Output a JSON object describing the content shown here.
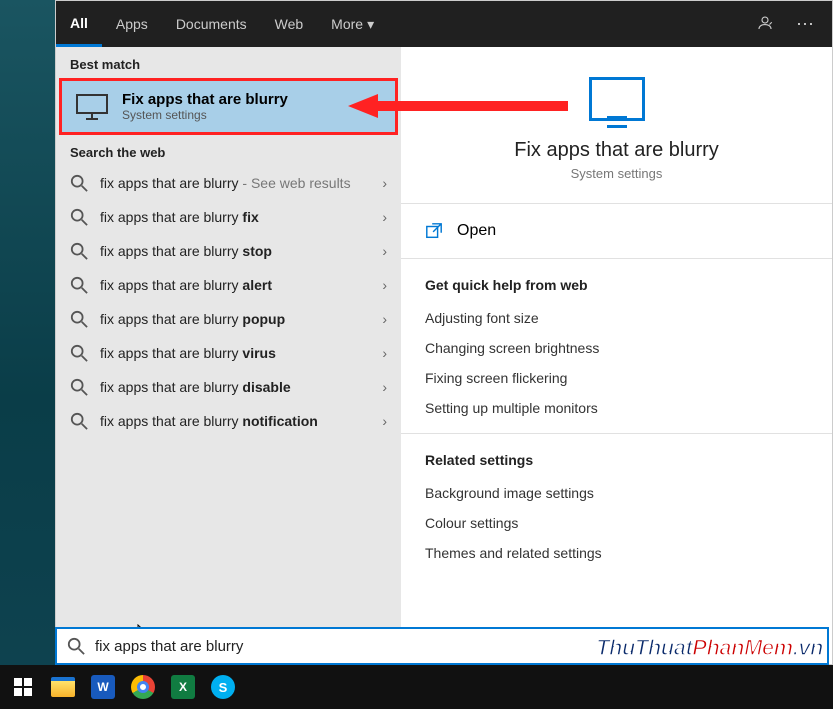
{
  "tabs": {
    "all": "All",
    "apps": "Apps",
    "documents": "Documents",
    "web": "Web",
    "more": "More"
  },
  "sections": {
    "best_match": "Best match",
    "search_web": "Search the web"
  },
  "best_match": {
    "title": "Fix apps that are blurry",
    "subtitle": "System settings"
  },
  "web": [
    {
      "base": "fix apps that are blurry",
      "suffix": "",
      "hint": " - See web results"
    },
    {
      "base": "fix apps that are blurry ",
      "suffix": "fix",
      "hint": ""
    },
    {
      "base": "fix apps that are blurry ",
      "suffix": "stop",
      "hint": ""
    },
    {
      "base": "fix apps that are blurry ",
      "suffix": "alert",
      "hint": ""
    },
    {
      "base": "fix apps that are blurry ",
      "suffix": "popup",
      "hint": ""
    },
    {
      "base": "fix apps that are blurry ",
      "suffix": "virus",
      "hint": ""
    },
    {
      "base": "fix apps that are blurry ",
      "suffix": "disable",
      "hint": ""
    },
    {
      "base": "fix apps that are blurry ",
      "suffix": "notification",
      "hint": ""
    }
  ],
  "preview": {
    "title": "Fix apps that are blurry",
    "subtitle": "System settings",
    "open": "Open"
  },
  "help": {
    "title": "Get quick help from web",
    "links": [
      "Adjusting font size",
      "Changing screen brightness",
      "Fixing screen flickering",
      "Setting up multiple monitors"
    ]
  },
  "related": {
    "title": "Related settings",
    "links": [
      "Background image settings",
      "Colour settings",
      "Themes and related settings"
    ]
  },
  "search_value": "fix apps that are blurry",
  "taskbar": {
    "word": "W",
    "excel": "X",
    "skype": "S"
  },
  "watermark": {
    "part1": "ThuThuat",
    "part2": "PhanMem",
    "part3": ".vn"
  },
  "glyphs": {
    "chevron_down": "▾",
    "chevron_right": "›",
    "more": "⋯"
  }
}
